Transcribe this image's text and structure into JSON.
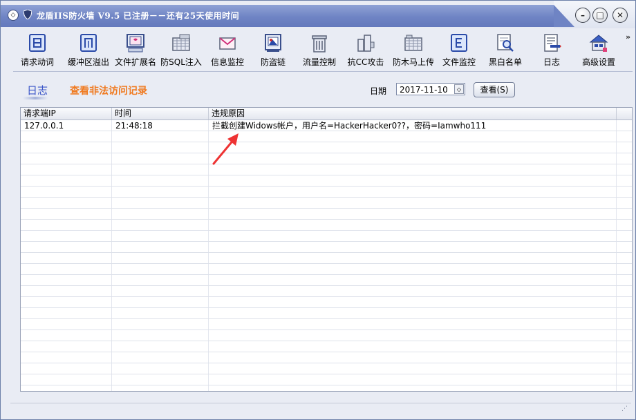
{
  "window": {
    "title": "龙盾IIS防火墙 V9.5 已注册－－还有25天使用时间",
    "minimize_icon": "minimize-icon",
    "maximize_icon": "maximize-icon",
    "close_icon": "close-icon"
  },
  "toolbar": {
    "items": [
      {
        "label": "请求动词",
        "icon": "list-icon"
      },
      {
        "label": "缓冲区溢出",
        "icon": "buffer-icon"
      },
      {
        "label": "文件扩展名",
        "icon": "monitor-icon"
      },
      {
        "label": "防SQL注入",
        "icon": "grid-icon"
      },
      {
        "label": "信息监控",
        "icon": "mail-icon"
      },
      {
        "label": "防盗链",
        "icon": "picture-icon"
      },
      {
        "label": "流量控制",
        "icon": "trash-icon"
      },
      {
        "label": "抗CC攻击",
        "icon": "towers-icon"
      },
      {
        "label": "防木马上传",
        "icon": "folder-grid-icon"
      },
      {
        "label": "文件监控",
        "icon": "file-e-icon"
      },
      {
        "label": "黑白名单",
        "icon": "magnify-doc-icon"
      },
      {
        "label": "日志",
        "icon": "log-icon"
      },
      {
        "label": "高级设置",
        "icon": "house-icon"
      }
    ],
    "more": "»"
  },
  "section": {
    "title": "日志",
    "subtitle": "查看非法访问记录",
    "date_label": "日期",
    "date_value": "2017-11-10",
    "query_button": "查看(S)"
  },
  "table": {
    "columns": [
      "请求端IP",
      "时间",
      "违规原因"
    ],
    "rows": [
      [
        "127.0.0.1",
        "21:48:18",
        "拦截创建Widows帐户，用户名=HackerHacker0??，密码=Iamwho111"
      ]
    ]
  },
  "colors": {
    "title_bar": "#6f84c4",
    "section_title": "#3a55c8",
    "section_subtitle": "#f07a20",
    "annotation_arrow": "#ee3333"
  }
}
